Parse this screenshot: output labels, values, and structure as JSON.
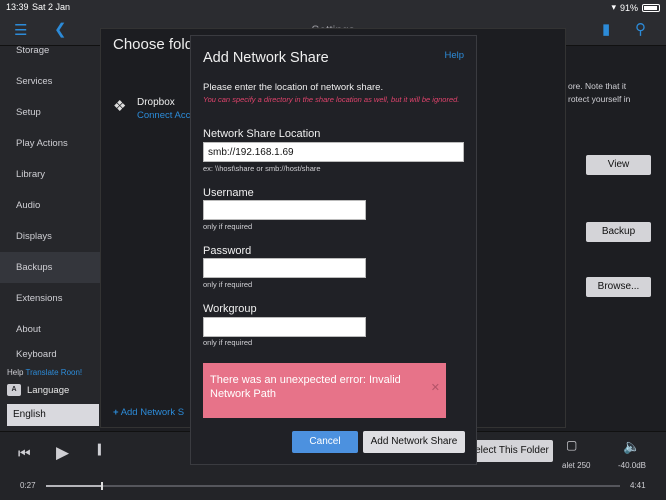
{
  "status": {
    "time": "13:39",
    "date": "Sat 2 Jan",
    "battery": "91%"
  },
  "nav": {
    "title": "Settings"
  },
  "sidebar": {
    "items": [
      {
        "label": "Storage"
      },
      {
        "label": "Services"
      },
      {
        "label": "Setup"
      },
      {
        "label": "Play Actions"
      },
      {
        "label": "Library"
      },
      {
        "label": "Audio"
      },
      {
        "label": "Displays"
      },
      {
        "label": "Backups"
      },
      {
        "label": "Extensions"
      },
      {
        "label": "About"
      },
      {
        "label": "Keyboard"
      }
    ],
    "help_prefix": "Help",
    "help_link": "Translate Roon!",
    "language_label": "Language",
    "language_value": "English"
  },
  "main": {
    "text1": "ore. Note that it",
    "text2": "rotect yourself in",
    "view_btn": "View",
    "backup_btn": "Backup",
    "browse_btn": "Browse..."
  },
  "folder_panel": {
    "title": "Choose fold",
    "dropbox_name": "Dropbox",
    "dropbox_sub": "Connect Acco",
    "add_share": "Add Network S",
    "select_folder": "elect This Folder"
  },
  "player": {
    "elapsed": "0:27",
    "total": "4:41",
    "zone": "alet 250",
    "volume": "-40.0dB",
    "progress": 0.096
  },
  "modal": {
    "title": "Add Network Share",
    "help": "Help",
    "intro": "Please enter the location of network share.",
    "hint": "You can specify a directory in the share location as well, but it will be ignored.",
    "location_label": "Network Share Location",
    "location_value": "smb://192.168.1.69",
    "location_note": "ex: \\\\host\\share or smb://host/share",
    "username_label": "Username",
    "username_note": "only if required",
    "password_label": "Password",
    "password_note": "only if required",
    "workgroup_label": "Workgroup",
    "workgroup_note": "only if required",
    "error": "There was an unexpected error: Invalid Network Path",
    "cancel": "Cancel",
    "add": "Add Network Share"
  }
}
